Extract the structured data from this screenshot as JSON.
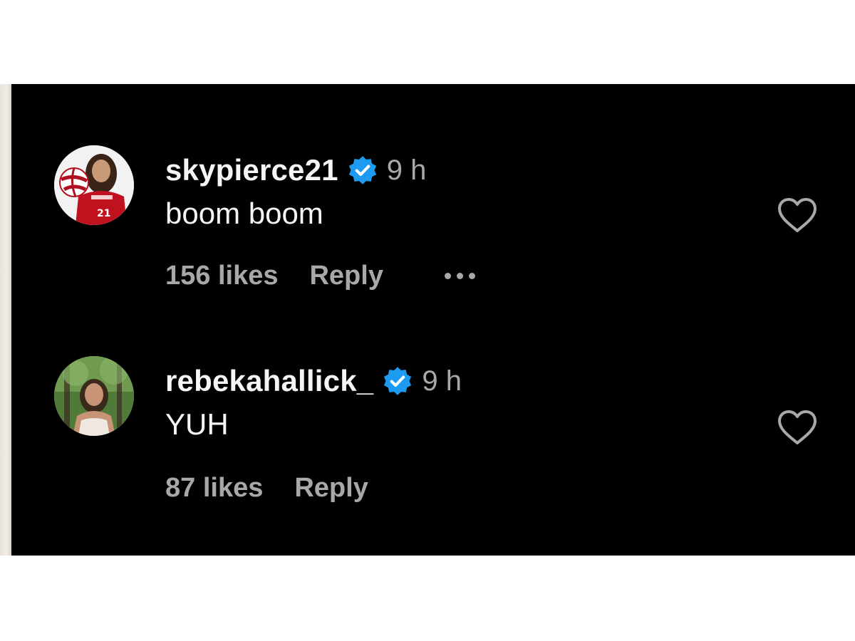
{
  "colors": {
    "background": "#000000",
    "primary_text": "#f5f5f5",
    "secondary_text": "#a8a8a8",
    "verified_badge": "#1d9bf0"
  },
  "comments": [
    {
      "username": "skypierce21",
      "verified_icon": "verified-badge-icon",
      "timestamp": "9 h",
      "text": "boom boom",
      "likes": "156 likes",
      "reply_label": "Reply",
      "has_more_options": true,
      "like_icon": "heart-outline-icon",
      "avatar_jersey_text": "21"
    },
    {
      "username": "rebekahallick_",
      "verified_icon": "verified-badge-icon",
      "timestamp": "9 h",
      "text": "YUH",
      "likes": "87 likes",
      "reply_label": "Reply",
      "has_more_options": false,
      "like_icon": "heart-outline-icon"
    }
  ]
}
